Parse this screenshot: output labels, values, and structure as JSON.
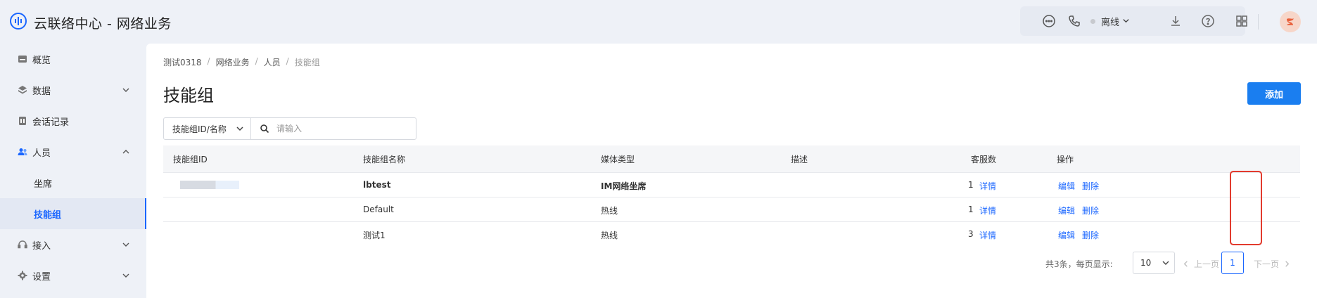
{
  "app": {
    "title": "云联络中心 - 网络业务"
  },
  "header": {
    "status_label": "离线",
    "icons": [
      "chat-bubble-icon",
      "phone-icon",
      "download-icon",
      "help-circle-icon",
      "grid-apps-icon",
      "avatar-icon"
    ]
  },
  "sidebar": {
    "items": [
      {
        "label": "概览",
        "icon": "dashboard-icon",
        "expandable": false
      },
      {
        "label": "数据",
        "icon": "layers-icon",
        "expandable": true,
        "expanded": false
      },
      {
        "label": "会话记录",
        "icon": "record-icon",
        "expandable": false
      },
      {
        "label": "人员",
        "icon": "users-icon",
        "expandable": true,
        "expanded": true
      },
      {
        "label": "坐席",
        "sub": true
      },
      {
        "label": "技能组",
        "sub": true,
        "active": true
      },
      {
        "label": "接入",
        "icon": "headset-icon",
        "expandable": true,
        "expanded": false
      },
      {
        "label": "设置",
        "icon": "gear-icon",
        "expandable": true,
        "expanded": false
      }
    ]
  },
  "breadcrumb": [
    "测试0318",
    "网络业务",
    "人员",
    "技能组"
  ],
  "page": {
    "title": "技能组",
    "add_label": "添加"
  },
  "filter": {
    "select_value": "技能组ID/名称",
    "search_placeholder": "请输入"
  },
  "table": {
    "columns": [
      "技能组ID",
      "技能组名称",
      "媒体类型",
      "描述",
      "客服数",
      "操作"
    ],
    "rows": [
      {
        "name": "lbtest",
        "media": "IM网络坐席",
        "desc": "",
        "count": "1",
        "detail": "详情",
        "edit": "编辑",
        "delete": "删除"
      },
      {
        "name": "Default",
        "media": "热线",
        "desc": "",
        "count": "1",
        "detail": "详情",
        "edit": "编辑",
        "delete": "删除"
      },
      {
        "name": "测试1",
        "media": "热线",
        "desc": "",
        "count": "3",
        "detail": "详情",
        "edit": "编辑",
        "delete": "删除"
      }
    ]
  },
  "pagination": {
    "total_text": "共3条，每页显示:",
    "page_size": "10",
    "prev_label": "上一页",
    "current_page": "1",
    "next_label": "下一页"
  },
  "colors": {
    "accent": "#1a66ff",
    "button": "#1a7ef0",
    "highlight": "#e23b2e"
  }
}
